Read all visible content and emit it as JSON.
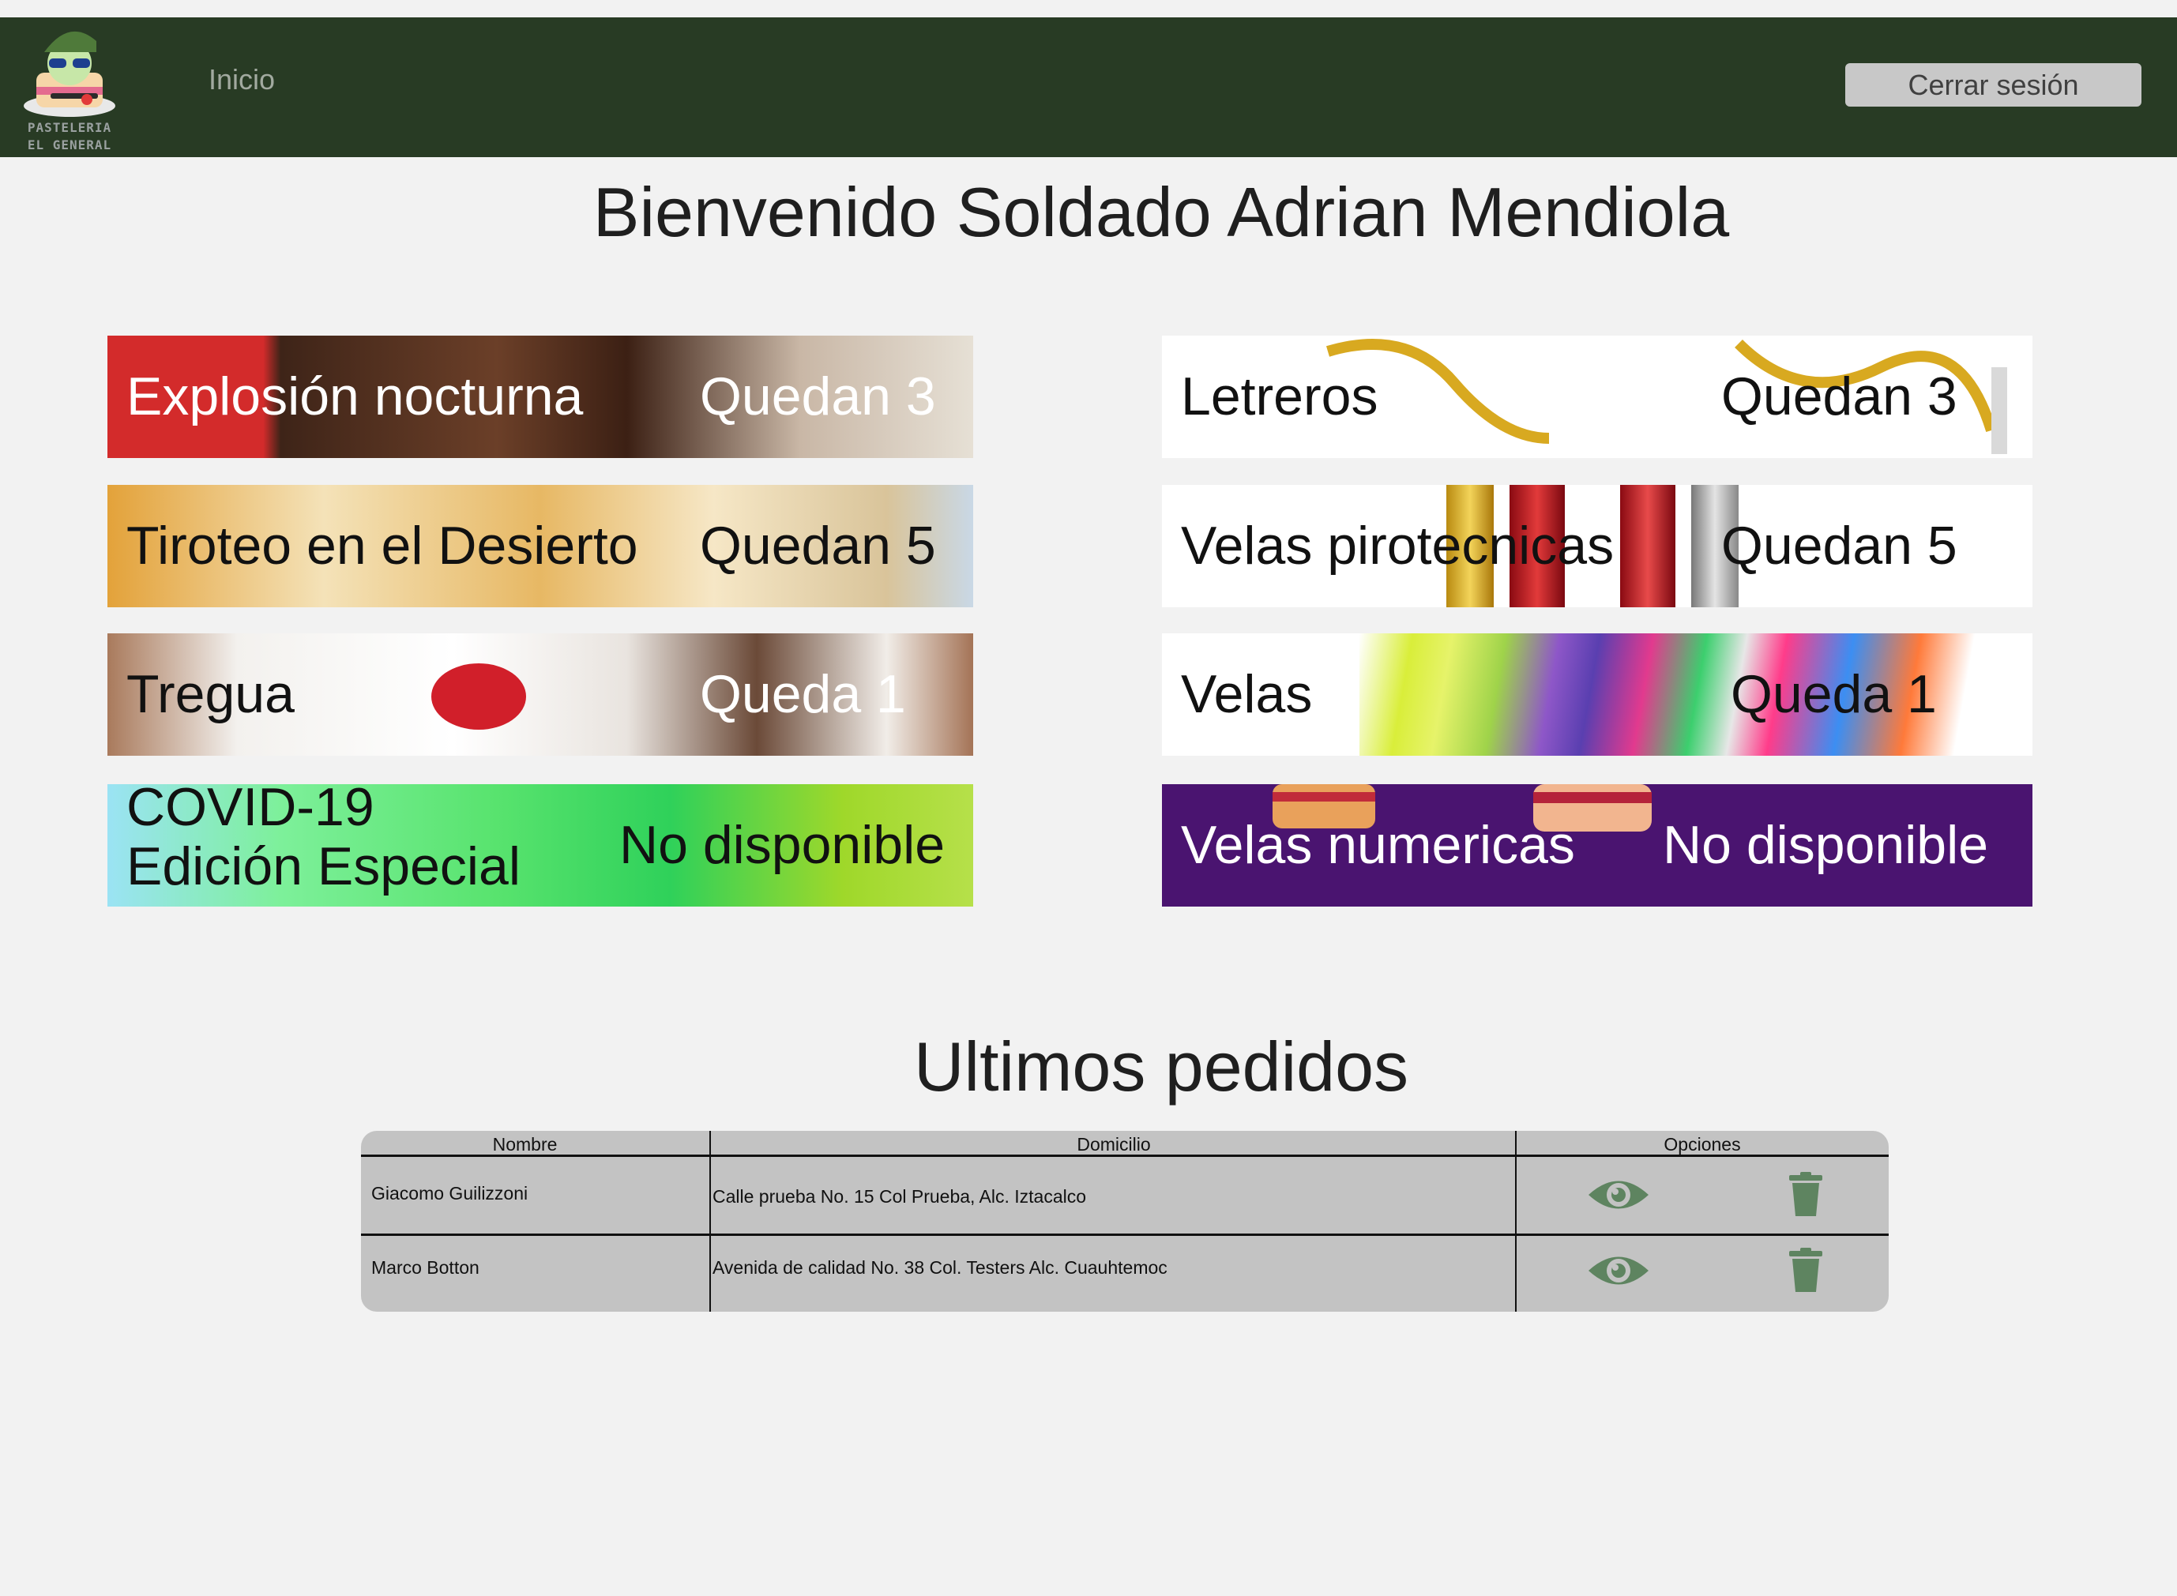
{
  "brand": {
    "line1": "PASTELERIA",
    "line2": "EL GENERAL"
  },
  "nav": {
    "home_label": "Inicio",
    "logout_label": "Cerrar sesión"
  },
  "welcome": "Bienvenido Soldado Adrian Mendiola",
  "products": [
    {
      "name": "Explosión nocturna",
      "stock": "Quedan 3"
    },
    {
      "name": "Letreros",
      "stock": "Quedan 3"
    },
    {
      "name": "Tiroteo en el Desierto",
      "stock": "Quedan 5"
    },
    {
      "name": "Velas pirotecnicas",
      "stock": "Quedan 5"
    },
    {
      "name": "Tregua",
      "stock": "Queda 1"
    },
    {
      "name": "Velas",
      "stock": "Queda 1"
    },
    {
      "name_line1": "COVID-19",
      "name_line2": "Edición Especial",
      "stock": "No disponible"
    },
    {
      "name": "Velas numericas",
      "stock": "No disponible"
    }
  ],
  "orders": {
    "title": "Ultimos pedidos",
    "headers": [
      "Nombre",
      "Domicilio",
      "Opciones"
    ],
    "rows": [
      {
        "name": "Giacomo Guilizzoni",
        "address": "Calle prueba No. 15 Col Prueba, Alc. Iztacalco"
      },
      {
        "name": "Marco Botton",
        "address": "Avenida de calidad No. 38 Col. Testers Alc. Cuauhtemoc"
      }
    ]
  },
  "colors": {
    "navbar": "#283b24",
    "icon_green": "#5e8460",
    "purple": "#4a1470"
  },
  "icons": {
    "view": "eye-icon",
    "delete": "trash-icon"
  }
}
